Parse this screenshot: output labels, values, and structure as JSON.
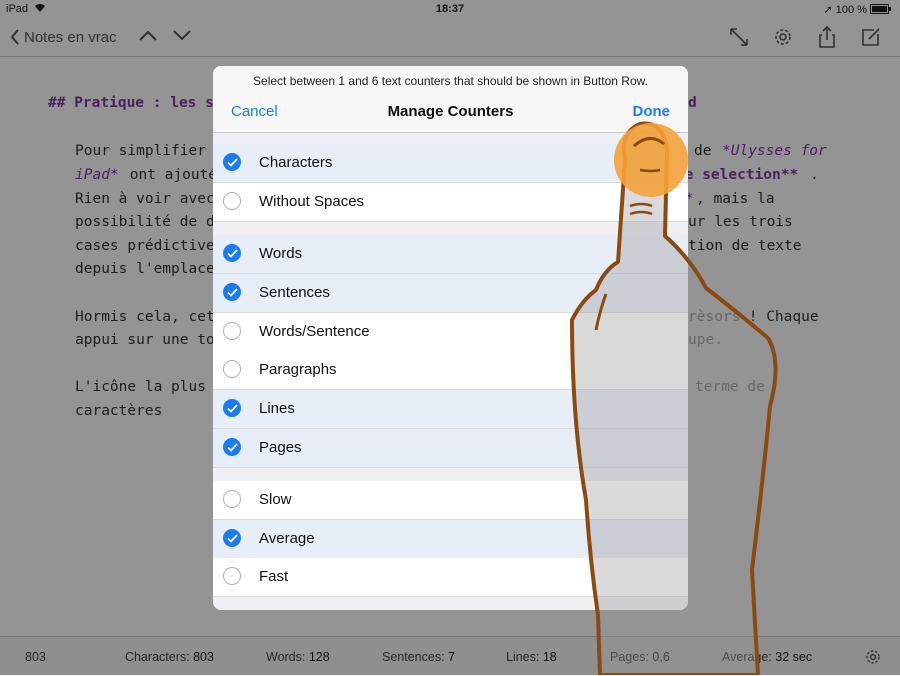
{
  "status": {
    "device": "iPad",
    "time": "18:37",
    "battery": "100 %"
  },
  "toolbar": {
    "back_label": "Notes en vrac"
  },
  "editor": {
    "lines": [
      {
        "text": "## Pratique : les s",
        "cls": "hdr"
      },
      {
        "text": "Pour simplifier",
        "cls": ""
      },
      {
        "text": "iPad*",
        "cls": "em"
      },
      {
        "text": " ont ajouté",
        "cls": ""
      },
      {
        "text": "Rien à voir avec",
        "cls": ""
      },
      {
        "text": "possibilité de d",
        "cls": ""
      },
      {
        "text": "cases prédictive",
        "cls": ""
      },
      {
        "text": "depuis l'emplace",
        "cls": ""
      },
      {
        "text": "Hormis cela, cet",
        "cls": ""
      },
      {
        "text": "appui sur une to",
        "cls": ""
      },
      {
        "text": "L'icône la plus",
        "cls": ""
      },
      {
        "text": "caractères",
        "cls": ""
      }
    ],
    "right_fragments": [
      {
        "text": "d",
        "cls": "hdr"
      },
      {
        "text": "de ",
        "cls": ""
      },
      {
        "text": "*Ulysses for",
        "cls": "em"
      },
      {
        "text": "pe selection**",
        "cls": "strong"
      },
      {
        "text": ".",
        "cls": ""
      },
      {
        "text": "h*",
        "cls": "em"
      },
      {
        "text": ", mais la",
        "cls": ""
      },
      {
        "text": "ur les trois",
        "cls": ""
      },
      {
        "text": "tion de texte",
        "cls": ""
      },
      {
        "text": "rèsors",
        "cls": "faded"
      },
      {
        "text": " ! Chaque",
        "cls": ""
      },
      {
        "text": "upe.",
        "cls": "faded"
      },
      {
        "text": "terme de",
        "cls": "faded"
      }
    ]
  },
  "popover": {
    "hint": "Select between 1 and 6 text counters that should be shown in Button Row.",
    "title": "Manage Counters",
    "cancel": "Cancel",
    "done": "Done",
    "rows": [
      {
        "label": "Characters",
        "checked": true
      },
      {
        "label": "Without Spaces",
        "checked": false
      },
      {
        "label": "Words",
        "checked": true
      },
      {
        "label": "Sentences",
        "checked": true
      },
      {
        "label": "Words/Sentence",
        "checked": false
      },
      {
        "label": "Paragraphs",
        "checked": false
      },
      {
        "label": "Lines",
        "checked": true
      },
      {
        "label": "Pages",
        "checked": true
      },
      {
        "label": "Slow",
        "checked": false
      },
      {
        "label": "Average",
        "checked": true
      },
      {
        "label": "Fast",
        "checked": false
      }
    ]
  },
  "bottom": {
    "count": "803",
    "characters_label": "Characters:",
    "characters": "803",
    "words_label": "Words:",
    "words": "128",
    "sentences_label": "Sentences:",
    "sentences": "7",
    "lines_label": "Lines:",
    "lines": "18",
    "pages_label": "Pages:",
    "pages": "0,6",
    "average_label": "Average:",
    "average": "32 sec"
  },
  "colors": {
    "accent": "#1a7cf2",
    "markdown": "#7a3aa0",
    "hand": "#f4a23a",
    "outline": "#8a4a12"
  }
}
